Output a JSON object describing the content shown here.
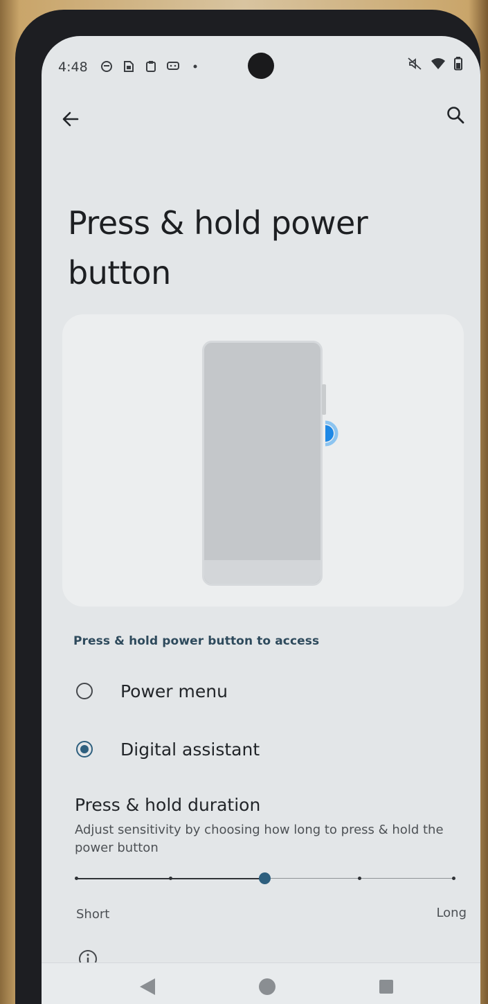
{
  "status_bar": {
    "time": "4:48",
    "left_icons": [
      "notification-icon",
      "sim-icon",
      "clipboard-icon",
      "message-icon",
      "dot-icon"
    ],
    "right_icons": [
      "mute-icon",
      "wifi-icon",
      "battery-icon"
    ]
  },
  "app_bar": {
    "back_icon": "arrow-back-icon",
    "search_icon": "search-icon"
  },
  "page": {
    "title": "Press & hold power button"
  },
  "access_section": {
    "header": "Press & hold power button to access",
    "options": [
      {
        "label": "Power menu",
        "selected": false
      },
      {
        "label": "Digital assistant",
        "selected": true
      }
    ]
  },
  "duration": {
    "title": "Press & hold duration",
    "subtitle": "Adjust sensitivity by choosing how long to press & hold the power button",
    "slider_min_label": "Short",
    "slider_max_label": "Long",
    "slider_steps": 5,
    "slider_value_index": 2
  },
  "colors": {
    "accent": "#2e5f7e",
    "background": "#e3e6e8"
  },
  "nav_bar": {
    "icons": [
      "nav-back-icon",
      "nav-home-icon",
      "nav-recents-icon"
    ]
  }
}
